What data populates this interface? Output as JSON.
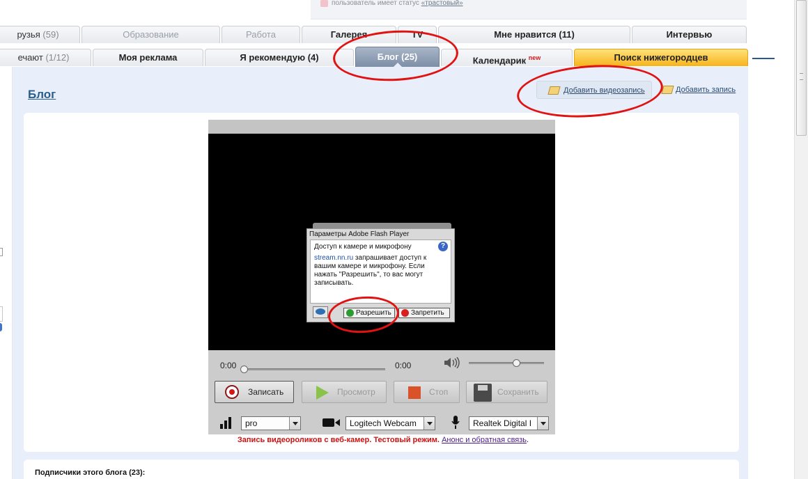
{
  "status_strip": {
    "text": "пользователь имеет статус ",
    "link": "«трастовый»"
  },
  "tabs_row1": [
    {
      "label": "рузья",
      "count": "(59)"
    },
    {
      "label": "Образование",
      "count": ""
    },
    {
      "label": "Работа",
      "count": ""
    },
    {
      "label": "Галерея",
      "count": ""
    },
    {
      "label": "TV",
      "count": ""
    },
    {
      "label": "Мне нравится (11)",
      "count": ""
    },
    {
      "label": "Интервью",
      "count": ""
    }
  ],
  "tabs_row2": [
    {
      "label": "ечают",
      "count": "(1/12)"
    },
    {
      "label": "Моя реклама",
      "count": ""
    },
    {
      "label": "Я рекомендую (4)",
      "count": ""
    },
    {
      "label": "Блог (25)",
      "count": ""
    },
    {
      "label": "Календарик",
      "badge": "new"
    },
    {
      "label": "Поиск нижегородцев",
      "count": ""
    }
  ],
  "page": {
    "title": "Блог",
    "add_video_label": "Добавить видеозапись",
    "add_post_label": "Добавить запись",
    "subscribers_title": "Подписчики этого блога (23):"
  },
  "player": {
    "time_current": "0:00",
    "time_total": "0:00",
    "progress": 0,
    "volume": 0.63,
    "buttons": {
      "record": "Записать",
      "preview": "Просмотр",
      "stop": "Стоп",
      "save": "Сохранить"
    },
    "quality_select": "pro",
    "camera_select": "Logitech Webcam",
    "mic_select": "Realtek Digital I"
  },
  "flash_dialog": {
    "title": "Параметры Adobe Flash Player",
    "heading": "Доступ к камере и микрофону",
    "site": "stream.nn.ru",
    "message": " запрашивает доступ к вашим камере и микрофону. Если нажать \"Разрешить\", то вас могут записывать.",
    "help": "?",
    "allow_label": "Разрешить",
    "deny_label": "Запретить"
  },
  "caption": {
    "text": "Запись видеороликов с веб-камер. Тестовый режим.",
    "link": "Анонс и обратная связь",
    "end": "."
  },
  "colors": {
    "accent_red": "#e01212",
    "active_tab": "#8595ad",
    "yellow_tab": "#f6b31c",
    "link_blue": "#2a5d8c"
  }
}
